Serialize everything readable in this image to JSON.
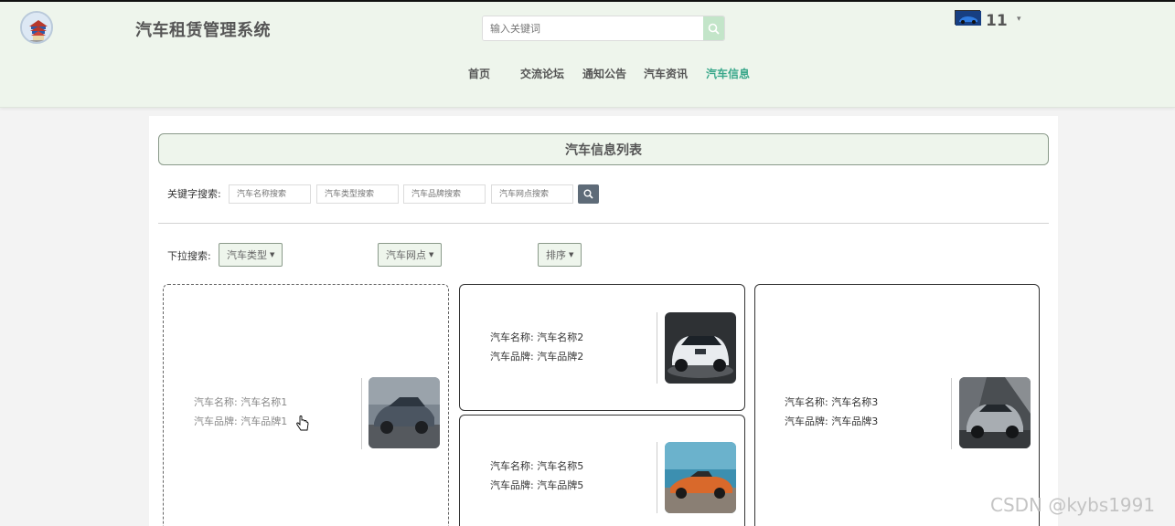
{
  "header": {
    "site_title": "汽车租赁管理系统",
    "search_placeholder": "输入关键词",
    "user_name": "11",
    "user_caret": "▾",
    "icons": {
      "logo": "temple-logo-icon",
      "search": "search-icon",
      "avatar": "car-avatar-icon"
    }
  },
  "nav": {
    "items": [
      {
        "label": "首页",
        "active": false
      },
      {
        "label": "交流论坛",
        "active": false
      },
      {
        "label": "通知公告",
        "active": false
      },
      {
        "label": "汽车资讯",
        "active": false
      },
      {
        "label": "汽车信息",
        "active": true
      }
    ]
  },
  "list": {
    "title": "汽车信息列表",
    "keyword_label": "关键字搜索:",
    "keyword_inputs": [
      {
        "placeholder": "汽车名称搜索"
      },
      {
        "placeholder": "汽车类型搜索"
      },
      {
        "placeholder": "汽车品牌搜索"
      },
      {
        "placeholder": "汽车网点搜索"
      }
    ],
    "dropdown_label": "下拉搜索:",
    "dropdowns": [
      {
        "label": "汽车类型"
      },
      {
        "label": "汽车网点"
      },
      {
        "label": "排序"
      }
    ],
    "cards": [
      {
        "name_line": "汽车名称: 汽车名称1",
        "brand_line": "汽车品牌: 汽车品牌1",
        "thumb_icon": "grey-suv-photo"
      },
      {
        "name_line": "汽车名称: 汽车名称2",
        "brand_line": "汽车品牌: 汽车品牌2",
        "thumb_icon": "white-suv-photo"
      },
      {
        "name_line": "汽车名称: 汽车名称3",
        "brand_line": "汽车品牌: 汽车品牌3",
        "thumb_icon": "silver-crossover-photo"
      },
      {
        "name_line": "汽车名称: 汽车名称5",
        "brand_line": "汽车品牌: 汽车品牌5",
        "thumb_icon": "orange-roadster-photo"
      }
    ]
  },
  "watermark": "CSDN @kybs1991",
  "colors": {
    "header_bg": "#eef5ec",
    "active_nav": "#3aa88b",
    "search_button": "#c3e5c9",
    "keyword_button": "#5e6b78"
  }
}
